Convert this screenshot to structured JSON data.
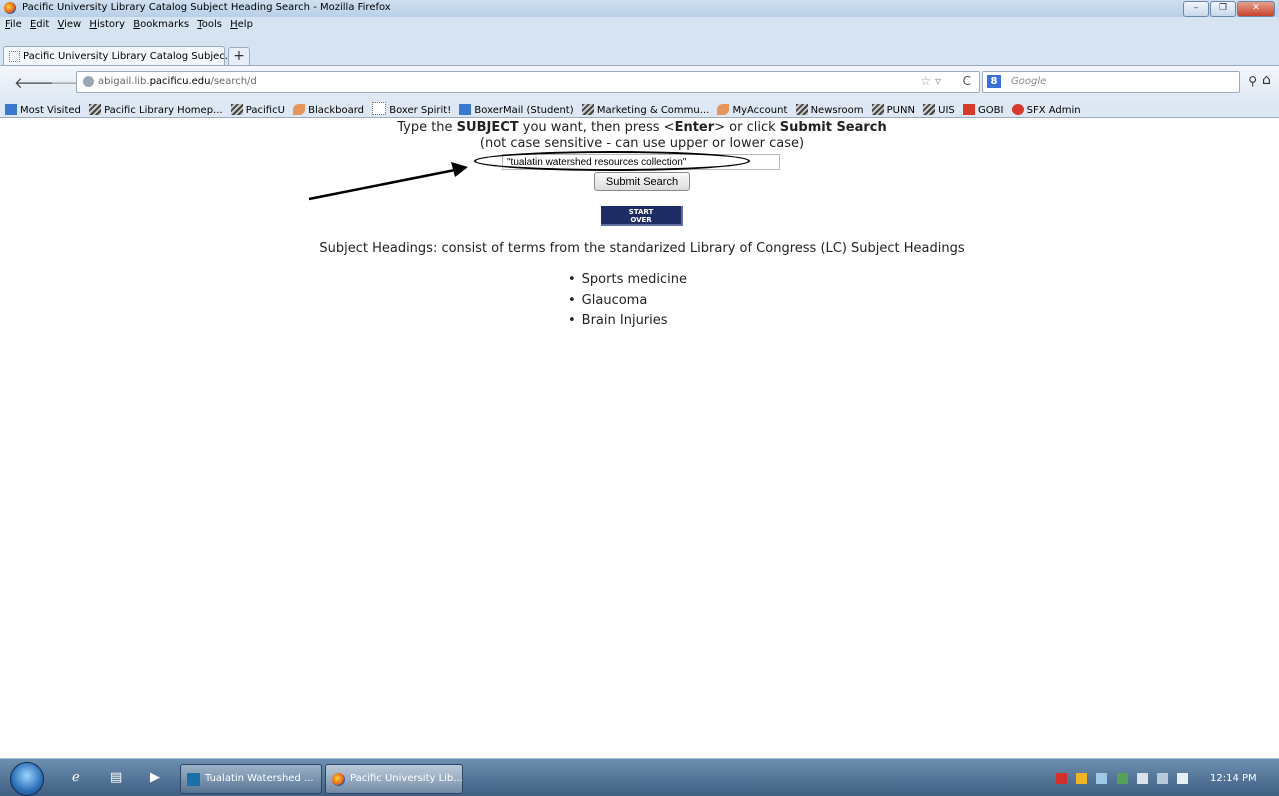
{
  "window": {
    "title": "Pacific University Library Catalog Subject Heading Search - Mozilla Firefox"
  },
  "menu": [
    "File",
    "Edit",
    "View",
    "History",
    "Bookmarks",
    "Tools",
    "Help"
  ],
  "tab": {
    "label": "Pacific University Library Catalog Subjec...",
    "new_tab": "+"
  },
  "nav": {
    "url_prefix": "abigail.lib.",
    "url_domain": "pacificu.edu",
    "url_path": "/search/d",
    "search_placeholder": "Google",
    "search_engine": "8"
  },
  "bookmarks": [
    {
      "label": "Most Visited",
      "icon": "i-blue"
    },
    {
      "label": "Pacific Library Homep...",
      "icon": "i-stripe"
    },
    {
      "label": "PacificU",
      "icon": "i-stripe"
    },
    {
      "label": "Blackboard",
      "icon": "i-leaf"
    },
    {
      "label": "Boxer Spirit!",
      "icon": "i-dot"
    },
    {
      "label": "BoxerMail (Student)",
      "icon": "i-blue"
    },
    {
      "label": "Marketing & Commu...",
      "icon": "i-stripe"
    },
    {
      "label": "MyAccount",
      "icon": "i-leaf"
    },
    {
      "label": "Newsroom",
      "icon": "i-stripe"
    },
    {
      "label": "PUNN",
      "icon": "i-stripe"
    },
    {
      "label": "UIS",
      "icon": "i-stripe"
    },
    {
      "label": "GOBI",
      "icon": "i-red"
    },
    {
      "label": "SFX Admin",
      "icon": "i-red"
    }
  ],
  "page": {
    "instr_a": "Type the ",
    "instr_subject": "SUBJECT",
    "instr_b": " you want, then press <",
    "instr_enter": "Enter",
    "instr_c": "> or click ",
    "instr_submit": "Submit Search",
    "instr_line2": "(not case sensitive - can use upper or lower case)",
    "search_value": "\"tualatin watershed resources collection\"",
    "submit_label": "Submit Search",
    "start_over_1": "START",
    "start_over_2": "OVER",
    "subject_headings": "Subject Headings: consist of terms from the standarized Library of Congress (LC) Subject Headings",
    "examples": [
      "Sports medicine",
      "Glaucoma",
      "Brain Injuries"
    ]
  },
  "taskbar": {
    "tasks": [
      "Tualatin Watershed ...",
      "Pacific University Lib..."
    ],
    "clock": "12:14 PM"
  },
  "colors": {
    "start_over_bg": "#1d2d64",
    "titlebar": "#c4d7ec",
    "taskbar": "#4f6f92"
  }
}
